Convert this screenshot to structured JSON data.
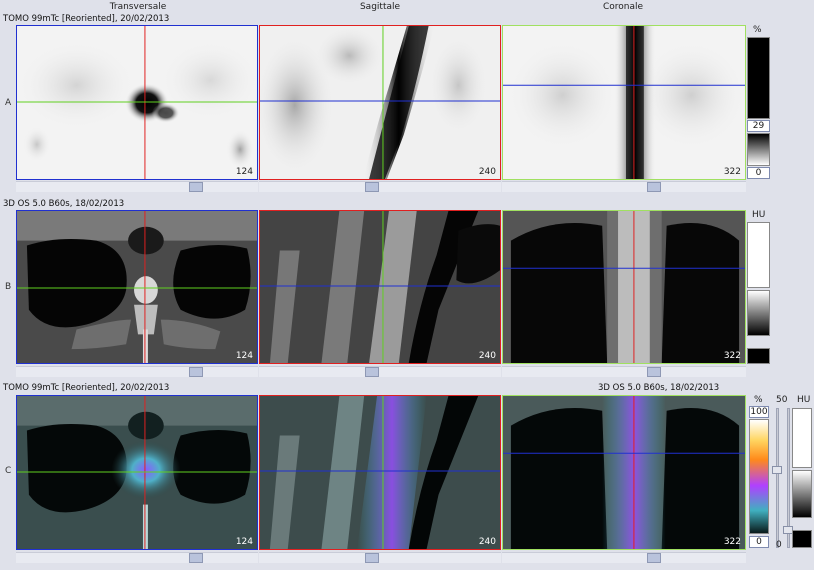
{
  "columns": {
    "transversale": "Transversale",
    "sagittale": "Sagittale",
    "coronale": "Coronale"
  },
  "rows": {
    "a": {
      "label": "A",
      "title": "TOMO 99mTc [Reoriented], 20/02/2013"
    },
    "b": {
      "label": "B",
      "title": "3D  OS  5.0  B60s, 18/02/2013"
    },
    "c": {
      "label": "C",
      "title_left": "TOMO 99mTc [Reoriented], 20/02/2013",
      "title_right": "3D  OS  5.0  B60s, 18/02/2013"
    }
  },
  "slices": {
    "transversale": "124",
    "sagittale": "240",
    "coronale": "322"
  },
  "scale_a": {
    "unit": "%",
    "upper": "29",
    "lower": "0"
  },
  "scale_b": {
    "unit": "HU"
  },
  "scale_c": {
    "unit_left": "%",
    "top_left": "100",
    "bottom_left": "0",
    "window": "50",
    "unit_right": "HU",
    "bottom_right": "0"
  },
  "colors": {
    "frame_red": "#e02020",
    "frame_green": "#a0e060",
    "frame_blue": "#2030d0",
    "background": "#dfe1ea"
  }
}
